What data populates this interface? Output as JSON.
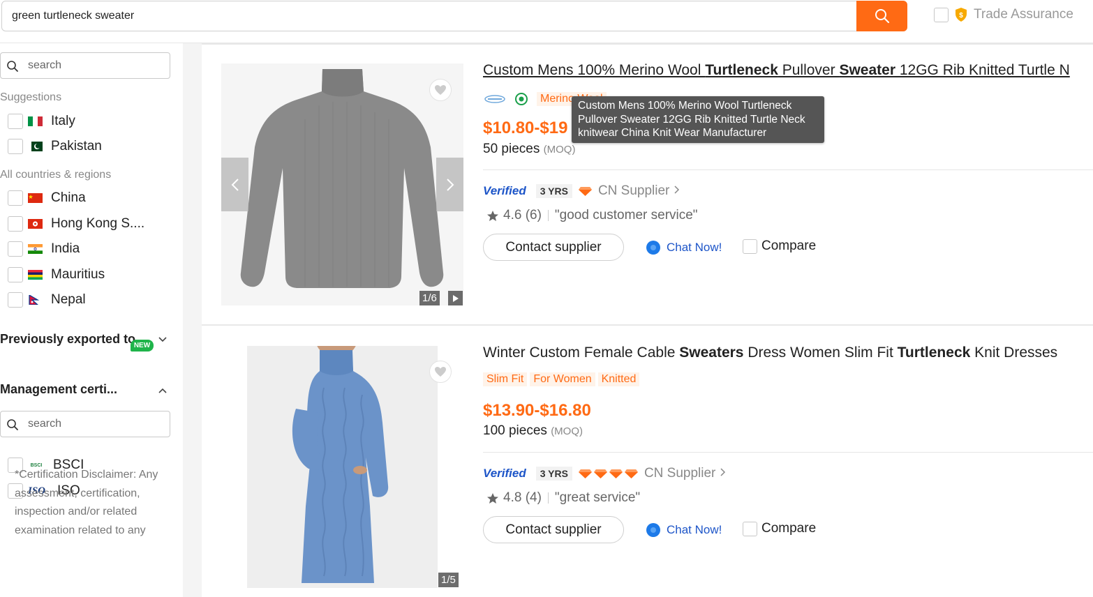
{
  "search": {
    "query": "green turtleneck sweater"
  },
  "trade_assurance": {
    "label": "Trade Assurance"
  },
  "sidebar": {
    "search_placeholder": "search",
    "suggestions_heading": "Suggestions",
    "suggestions": [
      {
        "label": "Italy",
        "flag": "italy-flag"
      },
      {
        "label": "Pakistan",
        "flag": "pakistan-flag"
      }
    ],
    "all_heading": "All countries & regions",
    "countries": [
      {
        "label": "China",
        "flag": "china-flag"
      },
      {
        "label": "Hong Kong S....",
        "flag": "hong-kong-flag"
      },
      {
        "label": "India",
        "flag": "india-flag"
      },
      {
        "label": "Mauritius",
        "flag": "mauritius-flag"
      },
      {
        "label": "Nepal",
        "flag": "nepal-flag"
      }
    ],
    "previously_exported": "Previously exported to",
    "management": "Management certi...",
    "new_badge": "NEW",
    "cert_search_placeholder": "search",
    "certs": [
      {
        "label": "BSCI",
        "logo_text": "BSCI"
      },
      {
        "label": "ISO",
        "logo_text": "ISO"
      }
    ],
    "disclaimer": "*Certification Disclaimer: Any assessment, certification, inspection and/or related examination related to any"
  },
  "products": [
    {
      "title_parts": [
        "Custom Mens 100% Merino Wool ",
        "Turtleneck",
        " Pullover ",
        "Sweater",
        " 12GG Rib Knitted Turtle N"
      ],
      "tag": "Merino Wool",
      "price": "$10.80-$19",
      "moq_qty": "50 pieces",
      "moq_label": "(MOQ)",
      "verified": "Verified",
      "yrs": "3 YRS",
      "diamond_count": 1,
      "supplier": "CN Supplier",
      "rating": "4.6 (6)",
      "review": "\"good customer service\"",
      "contact": "Contact supplier",
      "chat": "Chat Now!",
      "compare": "Compare",
      "image_counter": "1/6",
      "tooltip": "Custom Mens 100% Merino Wool Turtleneck Pullover Sweater 12GG Rib Knitted Turtle Neck knitwear China Knit Wear Manufacturer"
    },
    {
      "title_parts": [
        "Winter Custom Female Cable ",
        "Sweaters",
        " Dress Women Slim Fit ",
        "Turtleneck",
        " Knit Dresses"
      ],
      "tags": [
        "Slim Fit",
        "For Women",
        "Knitted"
      ],
      "price": "$13.90-$16.80",
      "moq_qty": "100 pieces",
      "moq_label": "(MOQ)",
      "verified": "Verified",
      "yrs": "3 YRS",
      "diamond_count": 4,
      "supplier": "CN Supplier",
      "rating": "4.8 (4)",
      "review": "\"great service\"",
      "contact": "Contact supplier",
      "chat": "Chat Now!",
      "compare": "Compare",
      "image_counter": "1/5"
    }
  ],
  "colors": {
    "accent": "#ff6a14",
    "verified_blue": "#1d55c8",
    "badge_green": "#1fb44a"
  }
}
